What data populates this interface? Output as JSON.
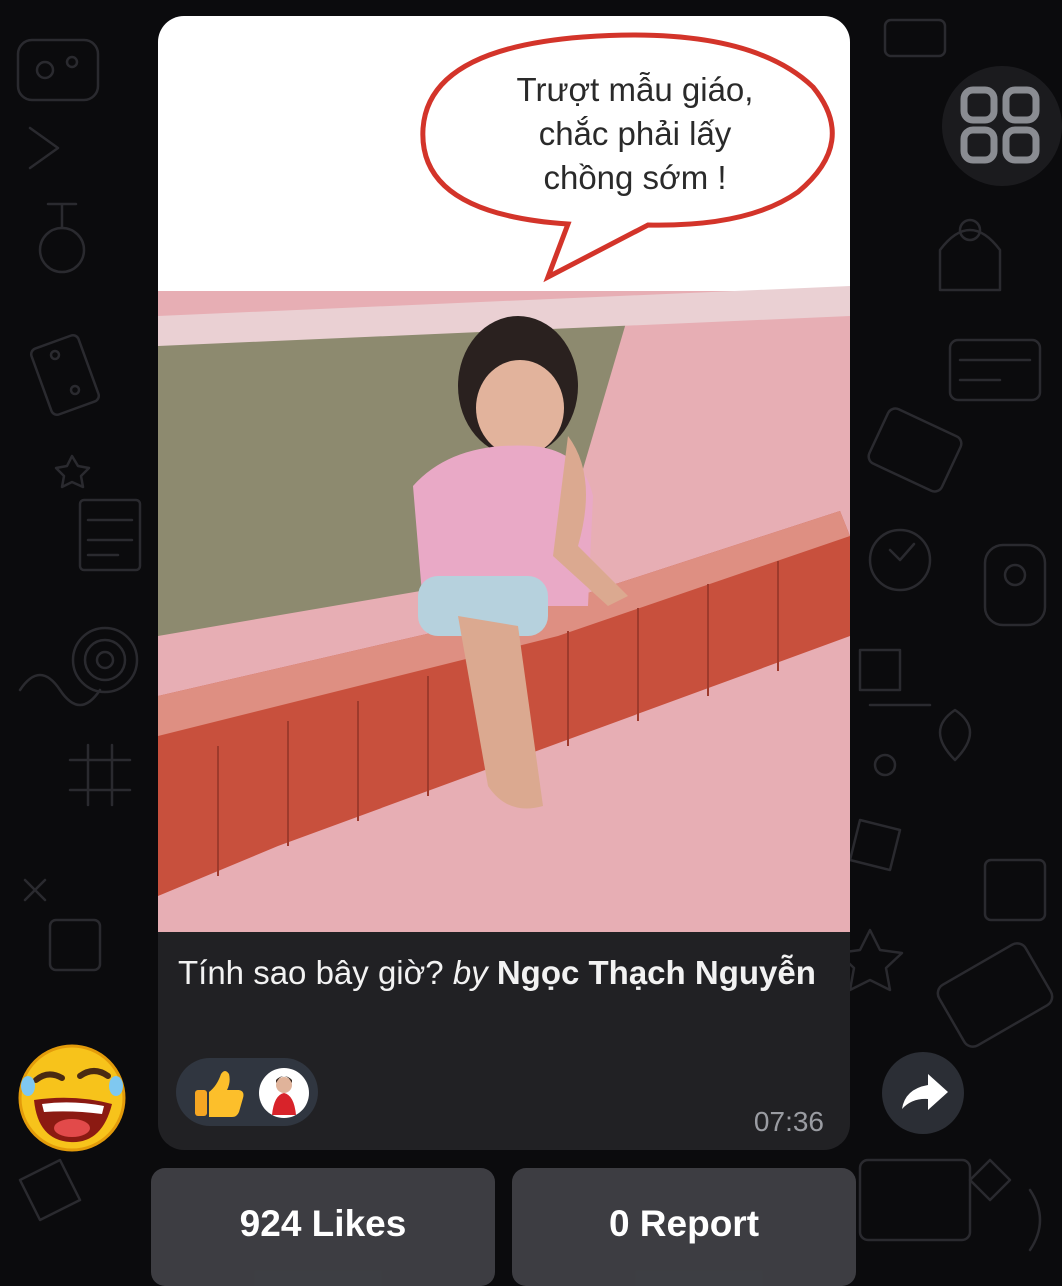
{
  "message": {
    "speech_bubble_text": [
      "Trượt mẫu giáo,",
      "chắc phải lấy",
      "chồng sớm !"
    ],
    "caption": {
      "text": "Tính sao bây giờ?",
      "by": "by",
      "author": "Ngọc Thạch Nguyễn"
    },
    "reactions": [
      {
        "icon": "thumbs-up-icon"
      },
      {
        "icon": "user-avatar"
      }
    ],
    "time": "07:36"
  },
  "actions": {
    "likes_label": "924 Likes",
    "report_label": "0 Report"
  },
  "icons": {
    "grid": "grid-icon",
    "share": "share-arrow-icon",
    "sticker": "laughing-emoji-icon"
  },
  "colors": {
    "background": "#0b0b0d",
    "bubble": "#212124",
    "reaction_pill": "#303640",
    "time_text": "#9a9ca2",
    "button": "#4b4c52"
  }
}
